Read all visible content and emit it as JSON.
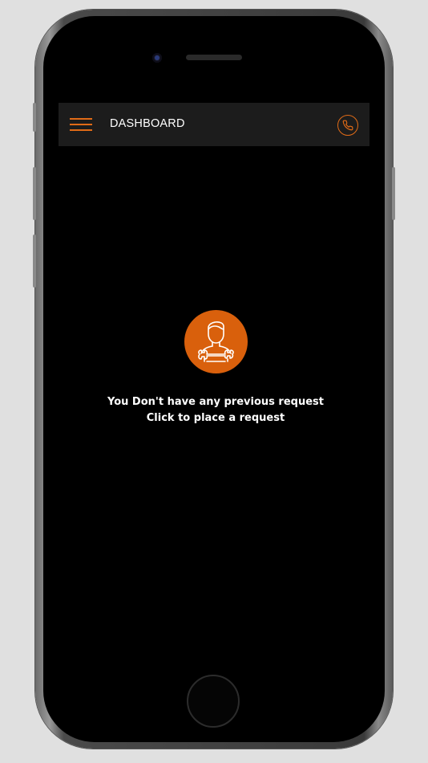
{
  "header": {
    "title": "DASHBOARD"
  },
  "icons": {
    "menu": "hamburger-menu-icon",
    "call": "phone-icon",
    "empty_state": "mechanic-wrench-icon"
  },
  "empty_state": {
    "message": "You Don't have any previous request",
    "action_text": "Click to place a request"
  },
  "colors": {
    "accent": "#e06b17",
    "icon_circle": "#d9600c",
    "topbar_bg": "#1c1c1c",
    "screen_bg": "#000000",
    "text": "#ffffff"
  }
}
